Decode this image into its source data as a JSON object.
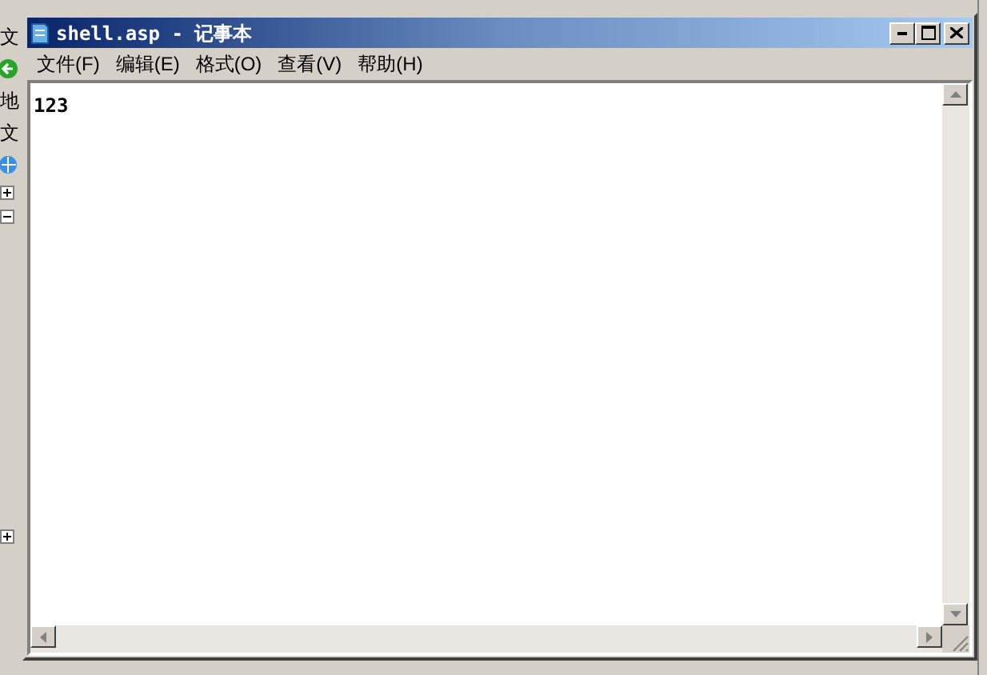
{
  "background_window": {
    "left_strip": [
      {
        "kind": "label",
        "text": "文"
      },
      {
        "kind": "back-icon"
      },
      {
        "kind": "label",
        "text": "地"
      },
      {
        "kind": "label",
        "text": "文"
      },
      {
        "kind": "globe-icon"
      },
      {
        "kind": "expander",
        "expanded": false
      },
      {
        "kind": "expander",
        "expanded": true
      },
      {
        "kind": "expander",
        "expanded": false
      }
    ]
  },
  "window": {
    "title": "shell.asp - 记事本"
  },
  "menu": [
    "文件(F)",
    "编辑(E)",
    "格式(O)",
    "查看(V)",
    "帮助(H)"
  ],
  "editor": {
    "text": "123"
  }
}
